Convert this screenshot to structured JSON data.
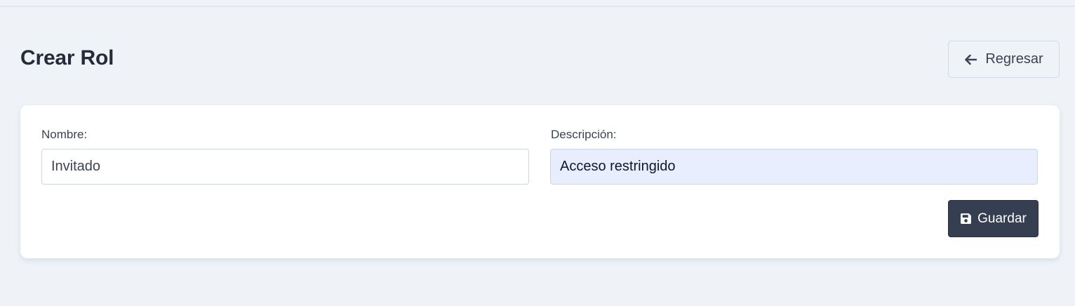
{
  "header": {
    "title": "Crear Rol",
    "back_label": "Regresar",
    "back_icon": "arrow-left-icon"
  },
  "form": {
    "nombre": {
      "label": "Nombre:",
      "value": "Invitado"
    },
    "descripcion": {
      "label": "Descripción:",
      "value": "Acceso restringido"
    },
    "save_label": "Guardar",
    "save_icon": "floppy-disk-icon"
  },
  "colors": {
    "page_bg": "#eff3f8",
    "card_bg": "#ffffff",
    "primary_button": "#363e52",
    "autofill_bg": "#e8eefd"
  }
}
